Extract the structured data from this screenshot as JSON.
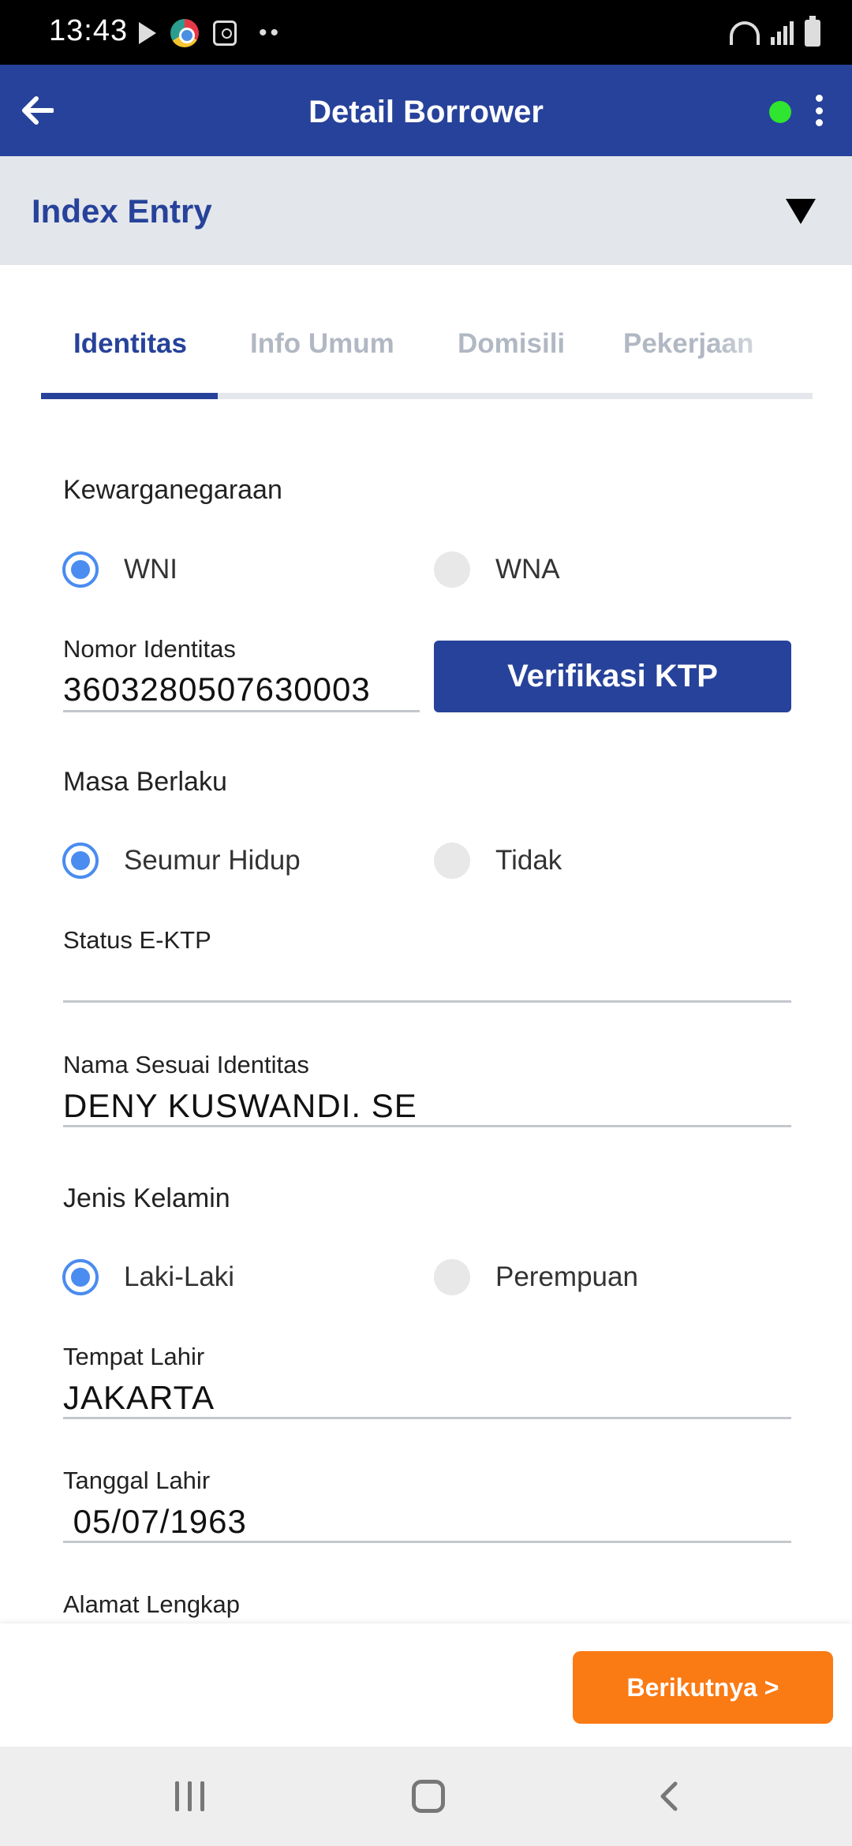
{
  "status_bar": {
    "time": "13:43",
    "left_icons": [
      "play-store-icon",
      "chrome-icon",
      "clock-app-icon",
      "more-notifications-icon"
    ],
    "right_icons": [
      "wifi-icon",
      "signal-icon",
      "battery-icon"
    ]
  },
  "header": {
    "title": "Detail Borrower",
    "online_color": "#2fe52f",
    "back_icon": "arrow-left-icon",
    "menu_icon": "kebab-menu-icon"
  },
  "section": {
    "title": "Index Entry",
    "caret_icon": "caret-down-icon"
  },
  "tabs": [
    {
      "label": "Identitas",
      "active": true
    },
    {
      "label": "Info Umum",
      "active": false
    },
    {
      "label": "Domisili",
      "active": false
    },
    {
      "label": "Pekerjaan",
      "active": false
    }
  ],
  "form": {
    "kewarganegaraan": {
      "label": "Kewarganegaraan",
      "options": [
        {
          "label": "WNI",
          "selected": true
        },
        {
          "label": "WNA",
          "selected": false
        }
      ]
    },
    "nomor_identitas": {
      "label": "Nomor Identitas",
      "value": "3603280507630003",
      "verify_button": "Verifikasi KTP"
    },
    "masa_berlaku": {
      "label": "Masa Berlaku",
      "options": [
        {
          "label": "Seumur Hidup",
          "selected": true
        },
        {
          "label": "Tidak",
          "selected": false
        }
      ]
    },
    "status_ektp": {
      "label": "Status E-KTP",
      "value": ""
    },
    "nama": {
      "label": "Nama Sesuai Identitas",
      "value": "DENY KUSWANDI. SE"
    },
    "jenis_kelamin": {
      "label": "Jenis Kelamin",
      "options": [
        {
          "label": "Laki-Laki",
          "selected": true
        },
        {
          "label": "Perempuan",
          "selected": false
        }
      ]
    },
    "tempat_lahir": {
      "label": "Tempat Lahir",
      "value": "JAKARTA"
    },
    "tanggal_lahir": {
      "label": "Tanggal Lahir",
      "value": " 05/07/1963"
    },
    "alamat": {
      "label": "Alamat Lengkap"
    }
  },
  "actions": {
    "next_label": "Berikutnya >"
  },
  "colors": {
    "primary": "#27429a",
    "accent": "#fa7a14",
    "radio": "#4a8cf0"
  }
}
